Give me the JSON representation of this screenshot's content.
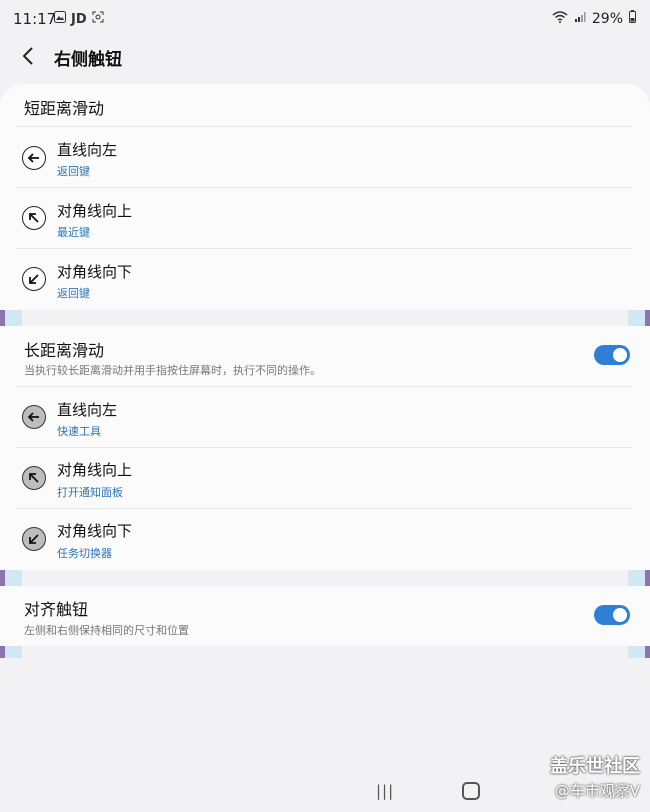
{
  "status_bar": {
    "time": "11:17",
    "left_extra": "JD",
    "battery": "29%"
  },
  "app_bar": {
    "title": "右侧触钮"
  },
  "short_swipe": {
    "heading": "短距离滑动",
    "items": [
      {
        "title": "直线向左",
        "value": "返回键",
        "icon": "arrow-left-icon"
      },
      {
        "title": "对角线向上",
        "value": "最近键",
        "icon": "arrow-up-left-icon"
      },
      {
        "title": "对角线向下",
        "value": "返回键",
        "icon": "arrow-down-left-icon"
      }
    ]
  },
  "long_swipe": {
    "heading": "长距离滑动",
    "description": "当执行较长距离滑动并用手指按住屏幕时，执行不同的操作。",
    "enabled": true,
    "items": [
      {
        "title": "直线向左",
        "value": "快速工具",
        "icon": "arrow-left-icon"
      },
      {
        "title": "对角线向上",
        "value": "打开通知面板",
        "icon": "arrow-up-left-icon"
      },
      {
        "title": "对角线向下",
        "value": "任务切换器",
        "icon": "arrow-down-left-icon"
      }
    ]
  },
  "align": {
    "heading": "对齐触钮",
    "description": "左侧和右侧保持相同的尺寸和位置",
    "enabled": true
  },
  "nav": {
    "recents": "|||"
  },
  "watermark": {
    "line1": "盖乐世社区",
    "line2": "@车市观察V"
  },
  "colors": {
    "accent": "#2f7fd6",
    "link": "#2b75b8",
    "edge_purple": "#8f73b0",
    "edge_blue": "#cfe8f3"
  }
}
